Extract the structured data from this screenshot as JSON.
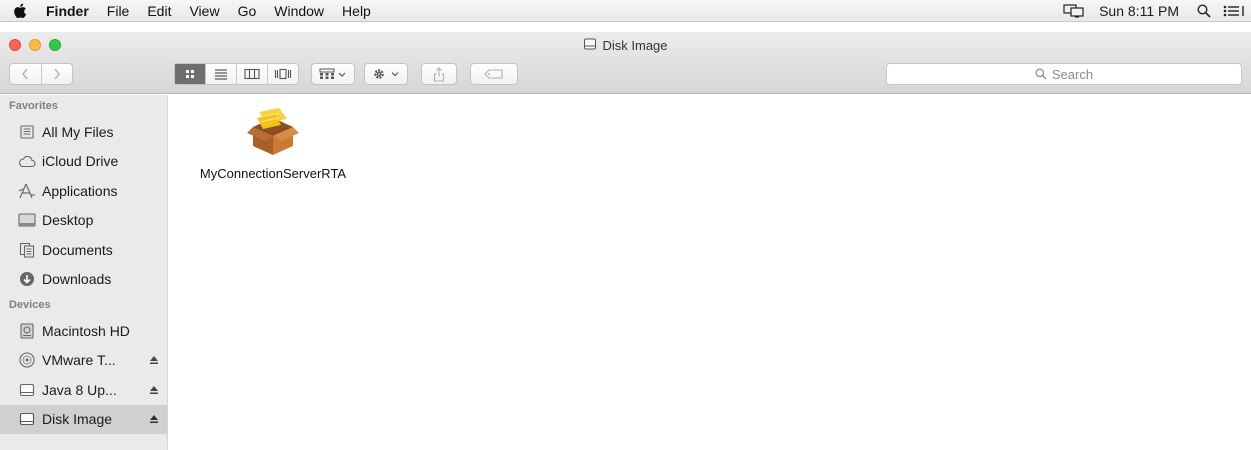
{
  "menubar": {
    "app": "Finder",
    "items": [
      "File",
      "Edit",
      "View",
      "Go",
      "Window",
      "Help"
    ],
    "clock": "Sun 8:11 PM",
    "icons": [
      "apple-icon",
      "display-icon",
      "spotlight-icon",
      "notification-center-icon"
    ]
  },
  "window": {
    "title": "Disk Image",
    "search_placeholder": "Search"
  },
  "sidebar": {
    "favorites_heading": "Favorites",
    "favorites": [
      {
        "label": "All My Files",
        "icon": "all-files-icon"
      },
      {
        "label": "iCloud Drive",
        "icon": "cloud-icon"
      },
      {
        "label": "Applications",
        "icon": "applications-icon"
      },
      {
        "label": "Desktop",
        "icon": "desktop-icon"
      },
      {
        "label": "Documents",
        "icon": "documents-icon"
      },
      {
        "label": "Downloads",
        "icon": "downloads-icon"
      }
    ],
    "devices_heading": "Devices",
    "devices": [
      {
        "label": "Macintosh HD",
        "icon": "hard-drive-icon"
      },
      {
        "label": "VMware T...",
        "icon": "disc-icon"
      },
      {
        "label": "Java 8 Up...",
        "icon": "disk-icon"
      },
      {
        "label": "Disk Image",
        "icon": "disk-icon"
      }
    ]
  },
  "content": {
    "files": [
      {
        "name": "MyConnectionServerRTA",
        "icon": "installer-package-icon"
      }
    ]
  }
}
